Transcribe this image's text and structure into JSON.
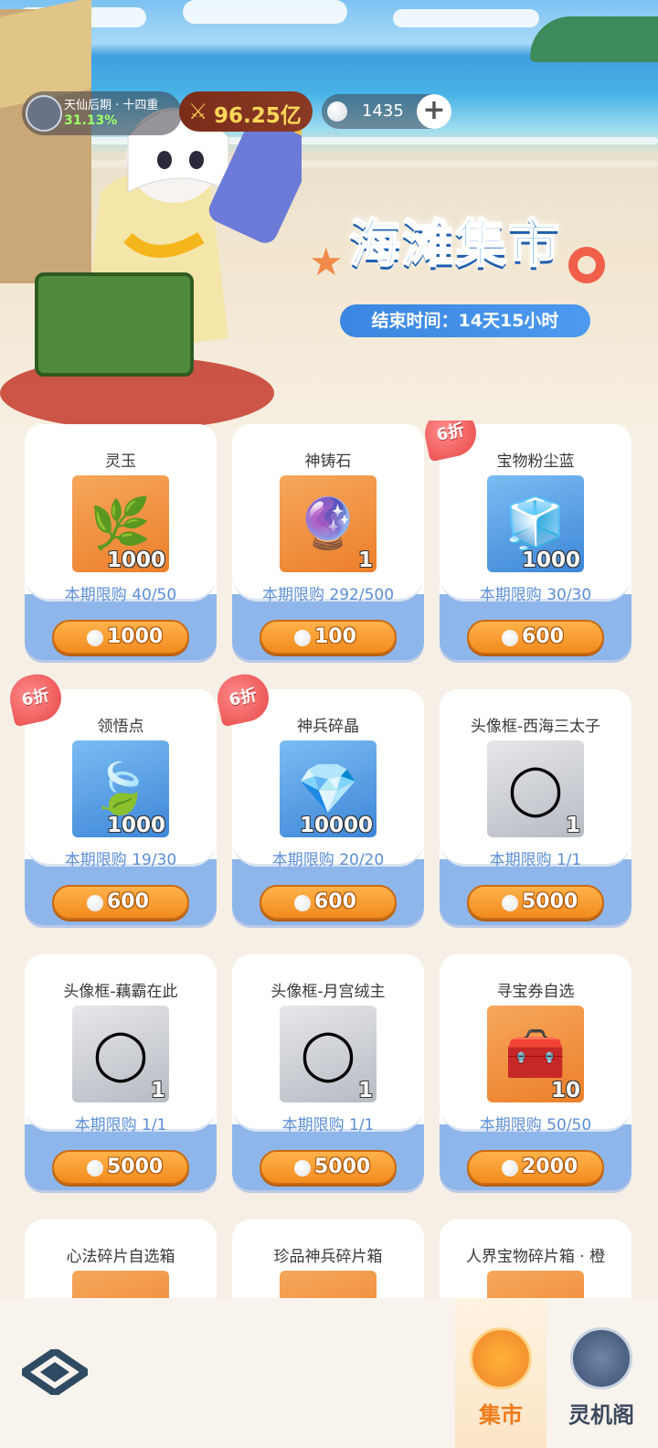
{
  "header": {
    "realm_name": "天仙后期 · 十四重",
    "realm_progress": "31.13%",
    "power_value": "96.25亿",
    "pearl_count": "1435",
    "add_label": "+"
  },
  "event": {
    "title": "海滩集市",
    "end_time": "结束时间：14天15小时"
  },
  "items": [
    {
      "title": "灵玉",
      "qty": "1000",
      "limit": "本期限购 40/50",
      "price": "1000",
      "discount": "",
      "bg": "orange",
      "icon": "🌿"
    },
    {
      "title": "神铸石",
      "qty": "1",
      "limit": "本期限购 292/500",
      "price": "100",
      "discount": "",
      "bg": "orange",
      "icon": "🔮"
    },
    {
      "title": "宝物粉尘蓝",
      "qty": "1000",
      "limit": "本期限购 30/30",
      "price": "600",
      "discount": "6折",
      "bg": "blue",
      "icon": "🧊"
    },
    {
      "title": "领悟点",
      "qty": "1000",
      "limit": "本期限购 19/30",
      "price": "600",
      "discount": "6折",
      "bg": "blue",
      "icon": "🍃"
    },
    {
      "title": "神兵碎晶",
      "qty": "10000",
      "limit": "本期限购 20/20",
      "price": "600",
      "discount": "6折",
      "bg": "blue",
      "icon": "💎"
    },
    {
      "title": "头像框-西海三太子",
      "qty": "1",
      "limit": "本期限购 1/1",
      "price": "5000",
      "discount": "",
      "bg": "gray",
      "icon": "◯"
    },
    {
      "title": "头像框-藕霸在此",
      "qty": "1",
      "limit": "本期限购 1/1",
      "price": "5000",
      "discount": "",
      "bg": "gray",
      "icon": "◯"
    },
    {
      "title": "头像框-月宫绒主",
      "qty": "1",
      "limit": "本期限购 1/1",
      "price": "5000",
      "discount": "",
      "bg": "gray",
      "icon": "◯"
    },
    {
      "title": "寻宝券自选",
      "qty": "10",
      "limit": "本期限购 50/50",
      "price": "2000",
      "discount": "",
      "bg": "orange",
      "icon": "🧰"
    },
    {
      "title": "心法碎片自选箱",
      "qty": "",
      "limit": "",
      "price": "",
      "discount": "",
      "bg": "orange",
      "icon": ""
    },
    {
      "title": "珍品神兵碎片箱",
      "qty": "",
      "limit": "",
      "price": "",
      "discount": "",
      "bg": "orange",
      "icon": ""
    },
    {
      "title": "人界宝物碎片箱 · 橙",
      "qty": "",
      "limit": "",
      "price": "",
      "discount": "",
      "bg": "orange",
      "icon": ""
    }
  ],
  "nav": {
    "market_label": "集市",
    "pavilion_label": "灵机阁"
  },
  "colors": {
    "accent_orange": "#f28b1e",
    "limit_blue": "#5a8ed6",
    "title_blue": "#2f8fe8"
  }
}
